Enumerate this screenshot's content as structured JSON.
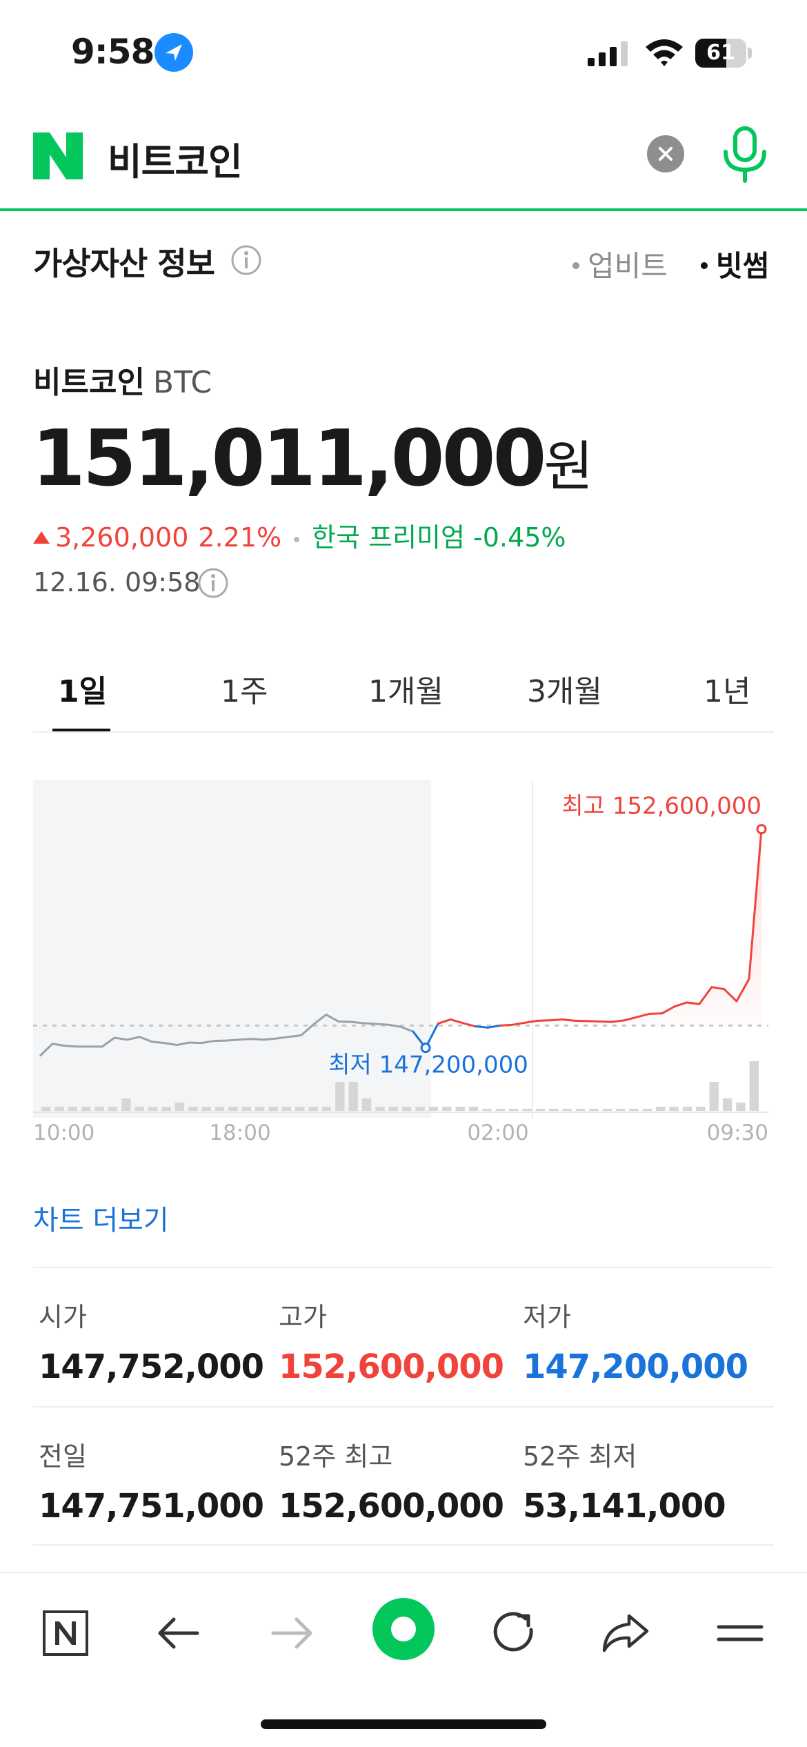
{
  "status_bar": {
    "time": "9:58",
    "battery": "61",
    "battery_level": 0.61
  },
  "search": {
    "query": "비트코인"
  },
  "section": {
    "title": "가상자산 정보",
    "sources": [
      "업비트",
      "빗썸"
    ],
    "active_source": "빗썸"
  },
  "coin": {
    "name": "비트코인",
    "symbol": "BTC",
    "price": "151,011,000",
    "unit": "원",
    "change": "3,260,000",
    "change_pct": "2.21%",
    "premium": "한국 프리미엄 -0.45%",
    "timestamp": "12.16. 09:58"
  },
  "tabs": [
    "1일",
    "1주",
    "1개월",
    "3개월",
    "1년"
  ],
  "active_tab": "1일",
  "chart_data": {
    "type": "line",
    "x_labels": [
      "10:00",
      "18:00",
      "02:00",
      "09:30"
    ],
    "high_label": "최고 152,600,000",
    "low_label": "최저 147,200,000",
    "high": 152600000,
    "low": 147200000,
    "series": [
      {
        "values": [
          147000000,
          147300000,
          147250000,
          147230000,
          147230000,
          147230000,
          147450000,
          147400000,
          147470000,
          147350000,
          147320000,
          147270000,
          147330000,
          147320000,
          147370000,
          147380000,
          147400000,
          147420000,
          147400000,
          147430000,
          147470000,
          147510000,
          147780000,
          148020000,
          147850000,
          147840000,
          147810000,
          147790000,
          147770000,
          147720000,
          147600000,
          147200000,
          147800000,
          147900000,
          147810000,
          147730000,
          147700000,
          147750000,
          147770000,
          147820000,
          147870000,
          147880000,
          147900000,
          147870000,
          147860000,
          147850000,
          147840000,
          147880000,
          147960000,
          148040000,
          148050000,
          148220000,
          148320000,
          148280000,
          148700000,
          148650000,
          148350000,
          148900000,
          152600000
        ]
      }
    ],
    "previous_close": 147751000,
    "volume": [
      1,
      1,
      1,
      1,
      1,
      1,
      3,
      1,
      1,
      1,
      2,
      1,
      1,
      1,
      1,
      1,
      1,
      1,
      1,
      1,
      1,
      1,
      7,
      7,
      3,
      1,
      1,
      1,
      1,
      1,
      1,
      1,
      1,
      0,
      0,
      0,
      0,
      0,
      0,
      0,
      0,
      0,
      0,
      0,
      0,
      0,
      1,
      1,
      1,
      1,
      7,
      3,
      2,
      12
    ],
    "grid": false
  },
  "chart_more": "차트 더보기",
  "stats": [
    [
      {
        "label": "시가",
        "value": "147,752,000",
        "color": "default"
      },
      {
        "label": "고가",
        "value": "152,600,000",
        "color": "red"
      },
      {
        "label": "저가",
        "value": "147,200,000",
        "color": "blue"
      }
    ],
    [
      {
        "label": "전일",
        "value": "147,751,000",
        "color": "default"
      },
      {
        "label": "52주 최고",
        "value": "152,600,000",
        "color": "default"
      },
      {
        "label": "52주 최저",
        "value": "53,141,000",
        "color": "default"
      }
    ]
  ],
  "colors": {
    "accent_green": "#03c75a",
    "up_red": "#f0433b",
    "down_blue": "#1a73d9",
    "chart_past": "#9aa1ab"
  }
}
